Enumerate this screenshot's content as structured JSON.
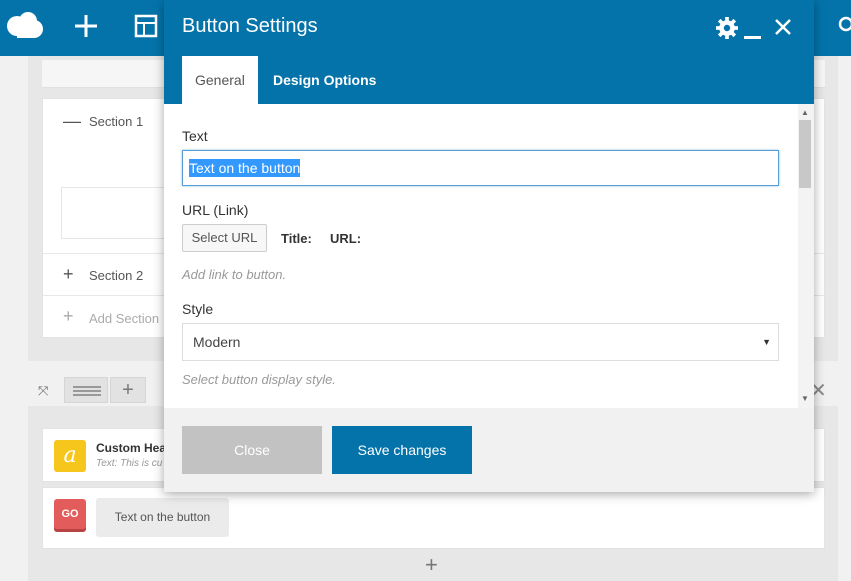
{
  "navbar": {
    "logo_icon": "cloud-logo-icon",
    "add_icon": "plus-icon",
    "templates_icon": "layout-icon",
    "search_icon": "search-icon",
    "color": "#0473aa"
  },
  "builder": {
    "sections": [
      {
        "symbol": "—",
        "label": "Section 1"
      },
      {
        "symbol": "+",
        "label": "Section 2"
      },
      {
        "symbol": "+",
        "label": "Add Section"
      }
    ],
    "elements": [
      {
        "icon": "a",
        "title": "Custom Hea",
        "subtitle": "Text: This is cu"
      },
      {
        "icon": "GO",
        "button_text": "Text on the button"
      }
    ],
    "add_symbol": "+",
    "close_symbol": "✕"
  },
  "modal": {
    "title": "Button Settings",
    "tabs": [
      {
        "label": "General",
        "active": true
      },
      {
        "label": "Design Options",
        "active": false
      }
    ],
    "fields": {
      "text_label": "Text",
      "text_value": "Text on the button",
      "url_label": "URL (Link)",
      "select_url_button": "Select URL",
      "title_label": "Title:",
      "url_value_label": "URL:",
      "url_hint": "Add link to button.",
      "style_label": "Style",
      "style_value": "Modern",
      "style_hint": "Select button display style."
    },
    "footer": {
      "close_label": "Close",
      "save_label": "Save changes"
    }
  }
}
